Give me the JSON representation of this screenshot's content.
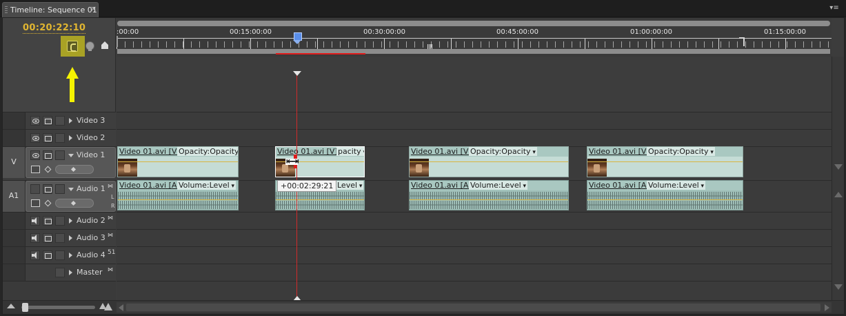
{
  "tab": {
    "title": "Timeline: Sequence 01",
    "close": "×"
  },
  "panel_menu": "▾≡",
  "timecode": "00:20:22:10",
  "ruler": {
    "labels": [
      ":00:00",
      "00:15:00:00",
      "00:30:00:00",
      "00:45:00:00",
      "01:00:00:00",
      "01:15:00:00"
    ]
  },
  "tracks": {
    "video3": {
      "name": "Video 3"
    },
    "video2": {
      "name": "Video 2"
    },
    "video1": {
      "name": "Video 1",
      "source": "V"
    },
    "audio1": {
      "name": "Audio 1",
      "source": "A1",
      "channel_l": "L",
      "channel_r": "R"
    },
    "audio2": {
      "name": "Audio 2"
    },
    "audio3": {
      "name": "Audio 3"
    },
    "audio4": {
      "name": "Audio 4",
      "badge": "51"
    },
    "master": {
      "name": "Master"
    }
  },
  "clips": {
    "video": [
      {
        "name": "Video 01.avi [V]",
        "effect": "Opacity:Opacity"
      },
      {
        "name": "Video 01.avi [V]",
        "effect": "pacity"
      },
      {
        "name": "Video 01.avi [V]",
        "effect": "Opacity:Opacity"
      },
      {
        "name": "Video 01.avi [V]",
        "effect": "Opacity:Opacity"
      }
    ],
    "audio": [
      {
        "name": "Video 01.avi [A]",
        "effect": "Volume:Level"
      },
      {
        "name": "",
        "effect": "Level"
      },
      {
        "name": "Video 01.avi [A]",
        "effect": "Volume:Level"
      },
      {
        "name": "Video 01.avi [A]",
        "effect": "Volume:Level"
      }
    ]
  },
  "tooltip": "+00:02:29:21",
  "colors": {
    "timecode": "#e0b531",
    "clip": "#c5dcd6",
    "playhead_line": "#d02a2a",
    "annotation_arrow": "#f5f300",
    "snap_highlight": "#a9a225"
  },
  "icons": [
    "snap-icon",
    "add-marker-icon",
    "set-keyframe-icon",
    "eye-icon",
    "sync-lock-icon",
    "speaker-icon",
    "collapse-triangle-icon",
    "zoom-out-icon",
    "zoom-in-icon"
  ]
}
